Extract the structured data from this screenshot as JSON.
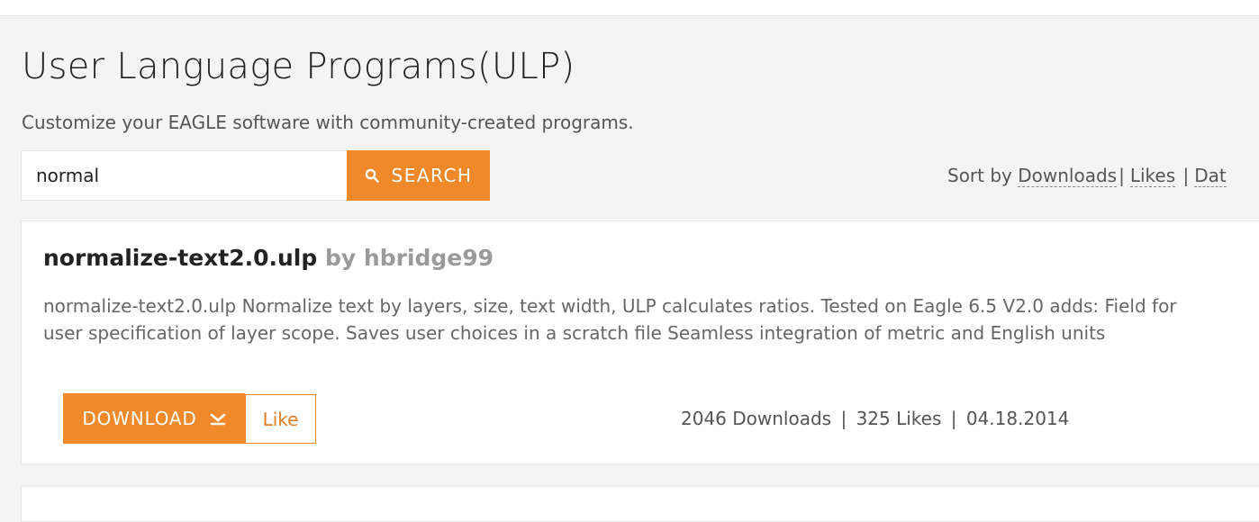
{
  "header": {
    "title": "User Language Programs(ULP)",
    "subtitle": "Customize your EAGLE software with community-created programs."
  },
  "search": {
    "value": "normal",
    "button_label": "SEARCH",
    "icon": "search-icon"
  },
  "sort": {
    "prefix": "Sort by",
    "options": [
      "Downloads",
      "Likes",
      "Dat"
    ],
    "separator": "|"
  },
  "results": [
    {
      "name": "normalize-text2.0.ulp",
      "by_label": "by",
      "author": "hbridge99",
      "description": "normalize-text2.0.ulp Normalize text by layers, size, text width, ULP calculates ratios. Tested on Eagle 6.5 V2.0 adds: Field for user specification of layer scope. Saves user choices in a scratch file Seamless integration of metric and English units",
      "download_label": "DOWNLOAD",
      "download_icon": "chevron-down-icon",
      "like_label": "Like",
      "downloads": "2046 Downloads",
      "likes": "325 Likes",
      "date": "04.18.2014",
      "stat_separator": "|"
    }
  ],
  "colors": {
    "accent": "#f0892a",
    "background": "#f4f4f4",
    "card": "#ffffff",
    "muted_text": "#9a9a9a"
  }
}
